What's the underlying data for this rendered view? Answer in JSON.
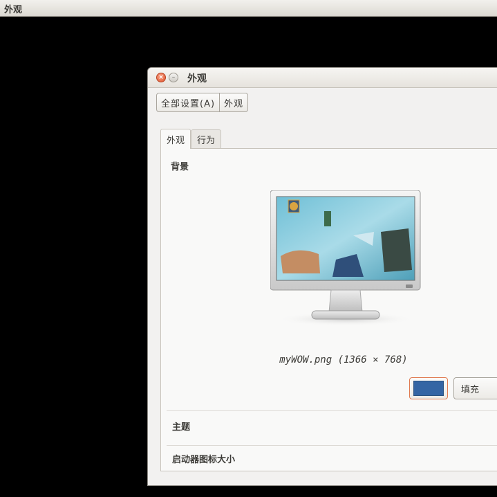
{
  "topbar": {
    "title": "外观"
  },
  "window": {
    "title": "外观",
    "close_icon": "×",
    "minimize_icon": "–"
  },
  "breadcrumb": {
    "items": [
      "全部设置(A)",
      "外观"
    ]
  },
  "tabs": [
    {
      "label": "外观",
      "active": true
    },
    {
      "label": "行为",
      "active": false
    }
  ],
  "background_section": {
    "title": "背景",
    "filename": "myWOW.png (1366 × 768)",
    "color": "#3465a4",
    "fill_mode": "填充"
  },
  "theme_section": {
    "title": "主题"
  },
  "launcher_section": {
    "title": "启动器图标大小"
  }
}
